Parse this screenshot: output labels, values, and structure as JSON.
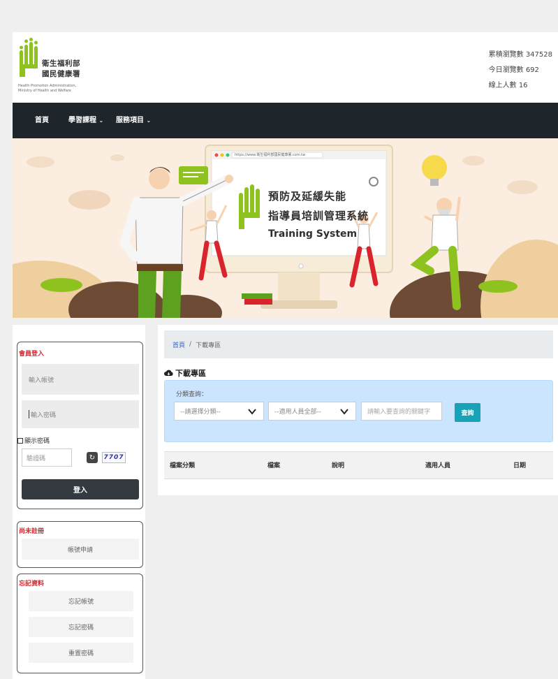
{
  "header": {
    "logo_name_line1": "衛生福利部",
    "logo_name_line2": "國民健康署",
    "logo_en_line1": "Health Promotion Administration,",
    "logo_en_line2": "Ministry of Health and Welfare",
    "stats": {
      "total_views": "累積瀏覽數 347528",
      "today_views": "今日瀏覽數 692",
      "online_users": "線上人數 16"
    }
  },
  "nav": {
    "home": "首頁",
    "courses": "學習課程",
    "services": "服務項目"
  },
  "banner": {
    "url_text": "https://www.衛生福利部國民健康署.com.tw",
    "title_line1": "預防及延緩失能",
    "title_line2": "指導員培訓管理系統",
    "title_en": "Training System"
  },
  "login": {
    "title": "會員登入",
    "account_placeholder": "輸入帳號",
    "password_placeholder": "輸入密碼",
    "show_password": "顯示密碼",
    "captcha_placeholder": "驗證碼",
    "captcha_code": "7707",
    "submit": "登入"
  },
  "register": {
    "title": "尚未註冊",
    "apply": "帳號申請"
  },
  "forgot": {
    "title": "忘記資料",
    "forgot_account": "忘記帳號",
    "forgot_password": "忘記密碼",
    "reset_password": "重置密碼"
  },
  "main": {
    "breadcrumb_home": "首頁",
    "breadcrumb_sep": "/",
    "breadcrumb_current": "下載專區",
    "section_title": "下載專區",
    "filter_label": "分類查詢：",
    "category_select": "--請選擇分類--",
    "user_select": "--適用人員全部--",
    "keyword_placeholder": "請輸入要查詢的關鍵字",
    "query_button": "查詢",
    "table_headers": [
      "檔案分類",
      "檔案",
      "說明",
      "適用人員",
      "日期"
    ]
  },
  "colors": {
    "nav_bg": "#1e252b",
    "logo_green": "#8dc21f",
    "accent_red": "#d9232d",
    "query_teal": "#17a2b8",
    "filter_bg": "#cce5ff"
  }
}
